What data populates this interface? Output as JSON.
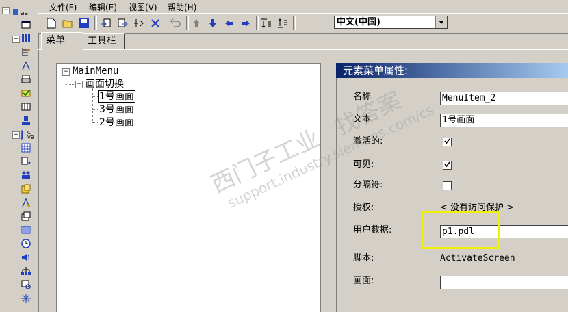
{
  "menubar": {
    "items": [
      "文件(F)",
      "编辑(E)",
      "视图(V)",
      "帮助(H)"
    ]
  },
  "toolbar": {
    "icons": [
      "new-icon",
      "open-icon",
      "save-icon",
      "import-icon",
      "export-icon",
      "add-icon",
      "delete-icon",
      "undo-icon",
      "move-up-icon",
      "move-down-icon",
      "move-left-icon",
      "move-right-icon",
      "insert-before-icon",
      "insert-after-icon"
    ],
    "language": "中文(中国)"
  },
  "tabs": [
    {
      "label": "菜单",
      "active": true
    },
    {
      "label": "工具栏",
      "active": false
    }
  ],
  "tree": {
    "root": "MainMenu",
    "group": "画面切换",
    "items": [
      "1号画面",
      "3号画面",
      "2号画面"
    ],
    "selected": "1号画面"
  },
  "properties": {
    "title": "元素菜单属性:",
    "name_label": "名称",
    "name_value": "MenuItem_2",
    "text_label": "文本",
    "text_value": "1号画面",
    "active_label": "激活的:",
    "active_checked": true,
    "visible_label": "可见:",
    "visible_checked": true,
    "separator_label": "分隔符:",
    "separator_checked": false,
    "auth_label": "授权:",
    "auth_value": "< 没有访问保护 >",
    "userdata_label": "用户数据:",
    "userdata_value": "p1.pdl",
    "script_label": "脚本:",
    "script_value": "ActivateScreen",
    "screen_label": "画面:",
    "screen_value": ""
  },
  "watermark": {
    "line1": "西门子工业",
    "line2": "support.industry.siemens.com/cs",
    "line3": "找答案"
  },
  "colors": {
    "header_gradient_start": "#0a246a",
    "header_gradient_end": "#a6caf0",
    "highlight": "#f0f000",
    "selection_border": "#000000"
  }
}
